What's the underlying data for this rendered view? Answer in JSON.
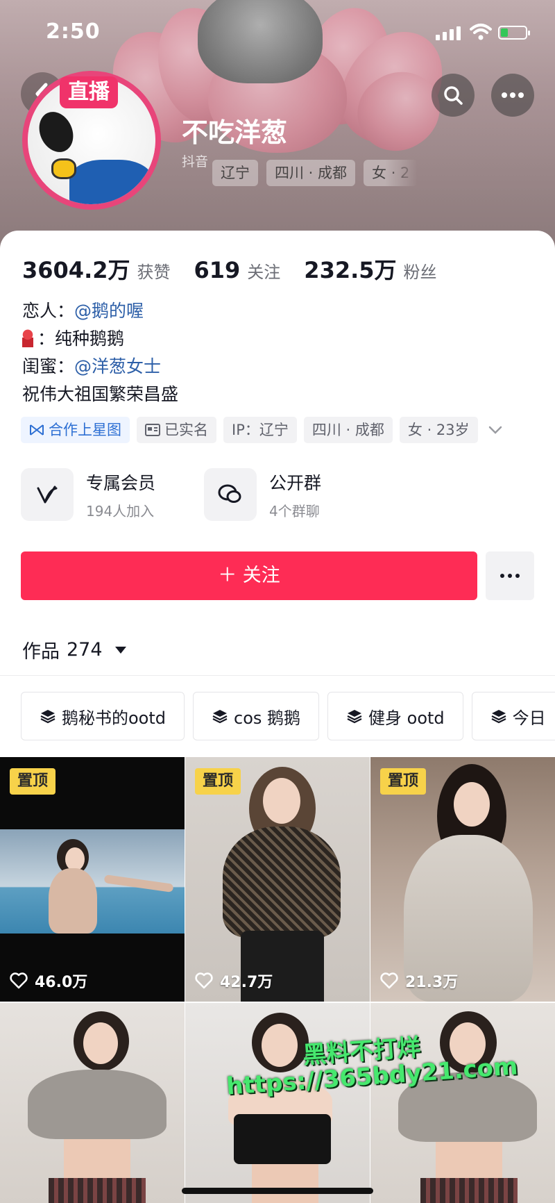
{
  "status_bar": {
    "time": "2:50"
  },
  "profile": {
    "live_badge": "直播",
    "username": "不吃洋葱",
    "platform": "抖音",
    "header_tags": [
      "辽宁",
      "四川 · 成都",
      "女 · 2"
    ]
  },
  "stats": [
    {
      "value": "3604.2万",
      "label": "获赞"
    },
    {
      "value": "619",
      "label": "关注"
    },
    {
      "value": "232.5万",
      "label": "粉丝"
    }
  ],
  "bio": {
    "line1_prefix": "恋人：",
    "line1_mention": "@鹅的喔",
    "line2": "：纯种鹅鹅",
    "line3_prefix": "闺蜜：",
    "line3_mention": "@洋葱女士",
    "line4": "祝伟大祖国繁荣昌盛"
  },
  "tags": {
    "star": "合作上星图",
    "verified": "已实名",
    "ip": "IP：辽宁",
    "location": "四川 · 成都",
    "gender_age": "女 · 23岁"
  },
  "features": [
    {
      "title": "专属会员",
      "sub": "194人加入",
      "icon": "v-icon"
    },
    {
      "title": "公开群",
      "sub": "4个群聊",
      "icon": "chat-bubbles-icon"
    }
  ],
  "follow_button": "＋ 关注",
  "works": {
    "label": "作品",
    "count": "274"
  },
  "collections": [
    "鹅秘书的ootd",
    "cos 鹅鹅",
    "健身 ootd",
    "今日"
  ],
  "videos": [
    {
      "pinned": "置顶",
      "likes": "46.0万"
    },
    {
      "pinned": "置顶",
      "likes": "42.7万"
    },
    {
      "pinned": "置顶",
      "likes": "21.3万"
    },
    {
      "pinned": "",
      "likes": ""
    },
    {
      "pinned": "",
      "likes": ""
    },
    {
      "pinned": "",
      "likes": ""
    }
  ],
  "watermark": {
    "line1": "黑料不打烊",
    "line2": "https://365bdy21.com"
  },
  "colors": {
    "follow": "#fe2c55",
    "live": "#f0336a",
    "mention": "#2d5fa8",
    "pin": "#f7d24a",
    "star_tag": "#2d6fd3"
  }
}
